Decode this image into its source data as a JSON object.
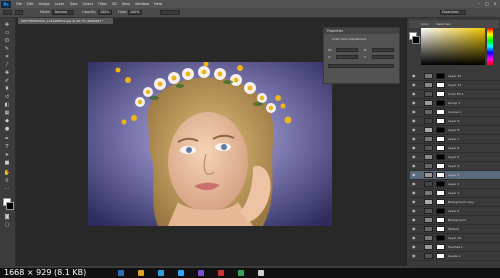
{
  "app": {
    "logo": "Ps",
    "menu": [
      "File",
      "Edit",
      "Image",
      "Layer",
      "Type",
      "Select",
      "Filter",
      "3D",
      "View",
      "Window",
      "Help"
    ]
  },
  "options": {
    "mode_label": "Mode:",
    "mode_value": "Normal",
    "opacity_label": "Opacity:",
    "opacity_value": "100%",
    "flow_label": "Flow:",
    "flow_value": "100%",
    "workspace": "Essentials"
  },
  "document": {
    "tab_title": "SHUTTERSTOCK_1130498522.jpg @ 66.7% (RGB/8#) *"
  },
  "properties": {
    "header": "Properties",
    "subtitle": "Solid Color Adjustment",
    "rows": [
      "W:",
      "H:",
      "X:",
      "Y:"
    ]
  },
  "colors": {
    "tab_color": "Color",
    "tab_swatches": "Swatches",
    "accent": "#f1c600",
    "foreground": "#ffffff",
    "background": "#000000"
  },
  "layers": {
    "items": [
      {
        "name": "Layer 12"
      },
      {
        "name": "Layer 11"
      },
      {
        "name": "Color Fill 1"
      },
      {
        "name": "Group 1"
      },
      {
        "name": "Curves 1"
      },
      {
        "name": "Layer 9"
      },
      {
        "name": "Layer 8"
      },
      {
        "name": "Layer 7"
      },
      {
        "name": "Layer 6"
      },
      {
        "name": "Layer 5"
      },
      {
        "name": "Layer 4"
      },
      {
        "name": "Layer 3"
      },
      {
        "name": "Layer 2"
      },
      {
        "name": "Layer 1"
      },
      {
        "name": "Background copy"
      },
      {
        "name": "Layer 0"
      },
      {
        "name": "Background"
      },
      {
        "name": "Texture"
      },
      {
        "name": "Layer 10"
      },
      {
        "name": "Hue/Sat 1"
      },
      {
        "name": "Levels 1"
      }
    ]
  },
  "status": {
    "video_overlay": "1668 × 929 (8.1 KB)"
  }
}
